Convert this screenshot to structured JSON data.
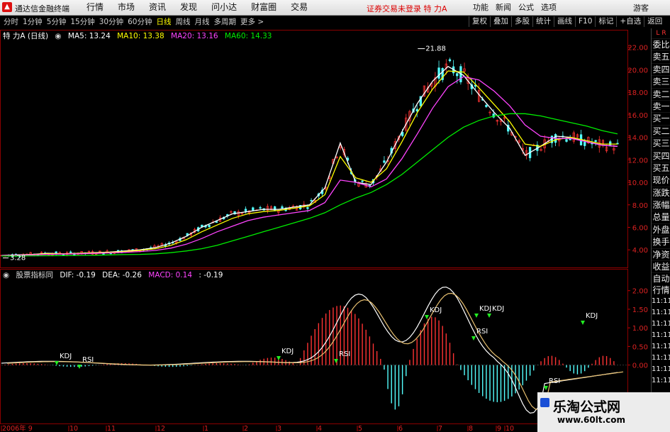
{
  "window": {
    "app_title": "通达信金融终端",
    "menu": [
      "行情",
      "市场",
      "资讯",
      "发现",
      "问小达",
      "财富圈",
      "交易"
    ],
    "notice": "证券交易未登录  特 力A",
    "right_menu": [
      "功能",
      "新闻",
      "公式",
      "选项"
    ],
    "sys_label": "游客"
  },
  "period_bar": {
    "tabs": [
      "分时",
      "1分钟",
      "5分钟",
      "15分钟",
      "30分钟",
      "60分钟",
      "日线",
      "周线",
      "月线",
      "多周期",
      "更多 >"
    ],
    "active_tab": "日线",
    "tools": [
      "复权",
      "叠加",
      "多股",
      "统计",
      "画线",
      "F10",
      "标记",
      "+自选",
      "返回"
    ]
  },
  "main_panel": {
    "stock_label": "特 力A (日线)",
    "indicators": [
      {
        "label": "MA5: 13.24",
        "color": "#ffffff"
      },
      {
        "label": "MA10: 13.38",
        "color": "#ffff00"
      },
      {
        "label": "MA20: 13.16",
        "color": "#ff44ff"
      },
      {
        "label": "MA60: 14.33",
        "color": "#00ee00"
      }
    ],
    "high_label": "21.88",
    "low_label": "3.28"
  },
  "sub_panel": {
    "label": "股票指标同",
    "indicators": [
      {
        "label": "DIF: -0.19",
        "color": "#ffffff"
      },
      {
        "label": "DEA: -0.26",
        "color": "#ffffff"
      },
      {
        "label": "MACD: 0.14",
        "color": "#ff44ff"
      },
      {
        "label": ": -0.19",
        "color": "#ffffff"
      }
    ],
    "signals": [
      {
        "text": "KDJ",
        "kind": "KDJ"
      },
      {
        "text": "RSI",
        "kind": "RSI"
      },
      {
        "text": "KDJ",
        "kind": "KDJ"
      },
      {
        "text": "RSI",
        "kind": "RSI"
      },
      {
        "text": "KDJ",
        "kind": "KDJ"
      },
      {
        "text": "KDJ",
        "kind": "KDJ"
      },
      {
        "text": "KDJ",
        "kind": "KDJ"
      },
      {
        "text": "RSI",
        "kind": "RSI"
      },
      {
        "text": "KDJ",
        "kind": "KDJ"
      },
      {
        "text": "RSI",
        "kind": "RSI"
      }
    ]
  },
  "right_panel": {
    "labels": [
      "委比",
      "卖五",
      "卖四",
      "卖三",
      "卖二",
      "卖一",
      "买一",
      "买二",
      "买三",
      "买四",
      "买五",
      "现价",
      "涨跌",
      "涨幅",
      "总量",
      "外盘",
      "换手",
      "净资",
      "收益"
    ],
    "sub_labels": [
      "自动",
      "行情",
      "11:11",
      "11:11",
      "11:11",
      "11:11",
      "11:11",
      "11:11",
      "11:11",
      "11:11",
      "11:11",
      "11:11",
      "11:11"
    ],
    "corner_mark": "L",
    "corner_mark2": "R"
  },
  "chart_data": {
    "type": "line",
    "price_axis": {
      "ticks": [
        "22.00",
        "20.00",
        "18.00",
        "16.00",
        "14.00",
        "12.00",
        "10.00",
        "8.00",
        "6.00",
        "4.00"
      ],
      "ylim": [
        2.5,
        22.8
      ]
    },
    "macd_axis": {
      "ticks": [
        "2.00",
        "1.50",
        "1.00",
        "0.50",
        "0.00"
      ],
      "ylim": [
        -1.4,
        2.3
      ]
    },
    "x_labels": [
      "2006年 9",
      "10",
      "11",
      "12",
      "1",
      "2",
      "3",
      "4",
      "5",
      "6",
      "7",
      "8",
      "9",
      "10"
    ],
    "series": [
      {
        "name": "MA5",
        "color": "#ffffff",
        "values": [
          3.5,
          3.55,
          3.6,
          3.7,
          3.65,
          3.7,
          3.75,
          3.8,
          3.9,
          4.0,
          4.2,
          4.6,
          5.2,
          6.0,
          6.6,
          7.2,
          7.4,
          7.6,
          7.6,
          7.8,
          8.0,
          9.5,
          13.5,
          10.0,
          9.8,
          11.8,
          14.5,
          17.0,
          19.0,
          20.3,
          19.5,
          17.8,
          16.2,
          14.8,
          12.4,
          13.2,
          14.1,
          14.0,
          13.6,
          13.3,
          13.2
        ]
      },
      {
        "name": "MA10",
        "color": "#ffff00",
        "values": [
          3.5,
          3.53,
          3.58,
          3.65,
          3.65,
          3.68,
          3.72,
          3.77,
          3.85,
          3.95,
          4.1,
          4.4,
          4.9,
          5.6,
          6.2,
          6.8,
          7.2,
          7.4,
          7.5,
          7.7,
          7.9,
          8.9,
          12.3,
          10.4,
          10.0,
          11.2,
          13.6,
          16.2,
          18.3,
          19.9,
          19.8,
          18.4,
          16.9,
          15.4,
          13.4,
          13.2,
          13.8,
          14.0,
          13.7,
          13.4,
          13.4
        ]
      },
      {
        "name": "MA20",
        "color": "#ff44ff",
        "values": [
          3.5,
          3.52,
          3.55,
          3.6,
          3.62,
          3.65,
          3.68,
          3.72,
          3.78,
          3.85,
          3.95,
          4.15,
          4.5,
          5.0,
          5.6,
          6.1,
          6.6,
          6.9,
          7.1,
          7.3,
          7.5,
          8.2,
          10.2,
          10.0,
          9.6,
          10.3,
          12.1,
          14.3,
          16.6,
          18.5,
          19.4,
          19.1,
          18.1,
          16.8,
          15.1,
          14.1,
          13.9,
          13.9,
          13.6,
          13.3,
          13.2
        ]
      },
      {
        "name": "MA60",
        "color": "#00ee00",
        "values": [
          3.45,
          3.46,
          3.47,
          3.48,
          3.49,
          3.5,
          3.52,
          3.55,
          3.58,
          3.6,
          3.65,
          3.75,
          3.9,
          4.1,
          4.4,
          4.8,
          5.2,
          5.6,
          6.0,
          6.4,
          6.8,
          7.3,
          8.0,
          8.6,
          9.1,
          9.8,
          10.7,
          11.8,
          12.9,
          14.0,
          14.9,
          15.5,
          15.9,
          16.1,
          16.1,
          15.9,
          15.6,
          15.3,
          15.0,
          14.6,
          14.3
        ]
      }
    ]
  }
}
